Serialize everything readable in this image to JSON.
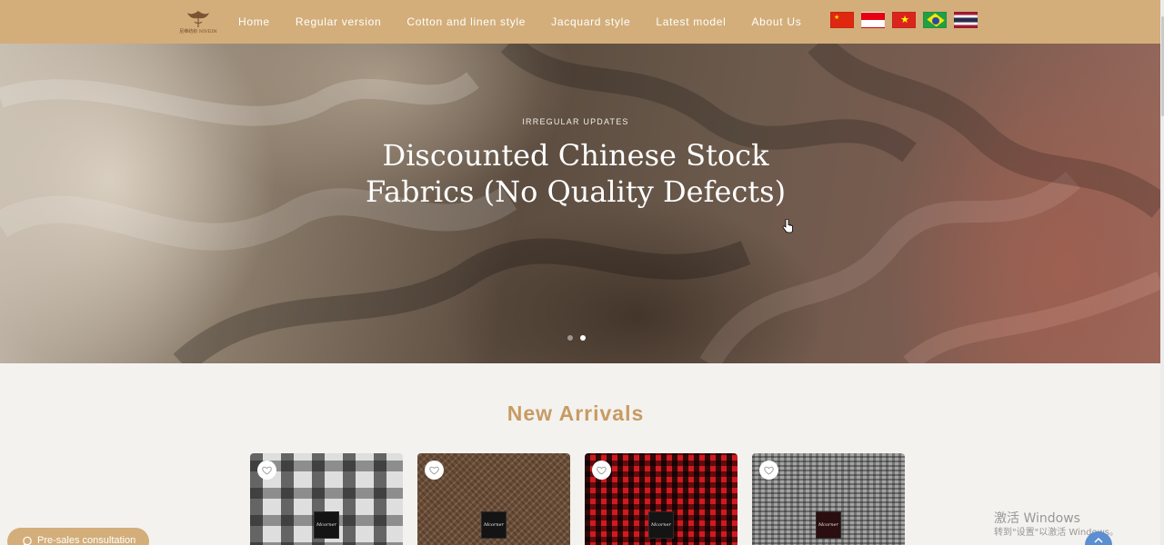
{
  "header": {
    "logo_text": "尼维纺织 NIVEIN",
    "nav": [
      {
        "label": "Home"
      },
      {
        "label": "Regular version"
      },
      {
        "label": "Cotton and linen style"
      },
      {
        "label": "Jacquard style"
      },
      {
        "label": "Latest model"
      },
      {
        "label": "About Us"
      }
    ],
    "flags": [
      {
        "icon": "china-flag-icon"
      },
      {
        "icon": "indonesia-flag-icon"
      },
      {
        "icon": "vietnam-flag-icon"
      },
      {
        "icon": "brazil-flag-icon"
      },
      {
        "icon": "thailand-flag-icon"
      }
    ],
    "background_color": "#d3ae7a"
  },
  "hero": {
    "eyebrow": "IRREGULAR UPDATES",
    "title": "Discounted Chinese Stock Fabrics (No Quality Defects)",
    "slides": 2,
    "active_slide": 2
  },
  "new_arrivals": {
    "title": "New Arrivals",
    "title_color": "#c79b63",
    "products": [
      {
        "name": "plaid-gray-black-fabric",
        "tag": "Mcorner"
      },
      {
        "name": "brown-tweed-fabric",
        "tag": "Mcorner"
      },
      {
        "name": "red-black-gingham-fabric",
        "tag": "Mcorner"
      },
      {
        "name": "gray-tweed-fabric",
        "tag": "Mcorner"
      }
    ]
  },
  "widgets": {
    "consult_label": "Pre-sales consultation",
    "watermark_line1": "激活 Windows",
    "watermark_line2": "转到\"设置\"以激活 Windows。"
  }
}
